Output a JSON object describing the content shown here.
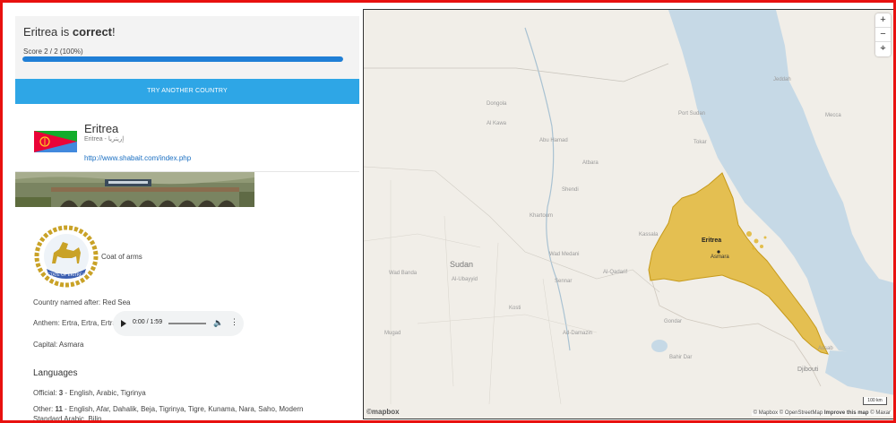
{
  "result": {
    "country": "Eritrea",
    "mid": " is ",
    "verdict": "correct",
    "end": "!",
    "score_text": "Score 2 / 2 (100%)",
    "score_fraction": 1.0
  },
  "try_button": "TRY ANOTHER COUNTRY",
  "card": {
    "name": "Eritrea",
    "native": "Eritrea - إريتريا",
    "url": "http://www.shabait.com/index.php"
  },
  "coat_of_arms_label": "Coat of arms",
  "coat_of_arms_motto": "STATE OF ERITREA",
  "named_after": "Country named after: Red Sea",
  "anthem": "Anthem: Ertra, Ertra, Ertra",
  "audio": {
    "time": "0:00 / 1:59",
    "progress_fraction": 0.0
  },
  "capital": "Capital: Asmara",
  "languages": {
    "heading": "Languages",
    "official_prefix": "Official: ",
    "official_count": "3",
    "official_list": " - English, Arabic, Tigrinya",
    "other_prefix": "Other: ",
    "other_count": "11",
    "other_list": " - English, Afar, Dahalik, Beja, Tigrinya, Tigre, Kunama, Nara, Saho, Modern Standard Arabic, Bilin"
  },
  "map": {
    "zoom_in": "+",
    "zoom_out": "−",
    "compass": "⌖",
    "labels": {
      "sudan": "Sudan",
      "eritrea": "Eritrea",
      "asmara": "Asmara",
      "djibouti": "Djibouti",
      "khartoum": "Khartoum",
      "port_sudan": "Port Sudan",
      "kassala": "Kassala",
      "wad_medani": "Wad Medani",
      "ad_damazin": "Ad-Damazin",
      "kosti": "Kosti",
      "al_ubayyid": "Al-Ubayyid",
      "wad_banda": "Wad Banda",
      "atbara": "Atbara",
      "dongola": "Dongola",
      "al_qadarif": "Al-Qadarif",
      "sennar": "Sennar",
      "al_kawa": "Al Kawa",
      "mugad": "Mugad",
      "shendi": "Shendi",
      "abu_hamad": "Abu Hamad",
      "tokar": "Tokar",
      "assab": "Assab",
      "jeddah": "Jeddah",
      "mecca": "Mecca",
      "bahir_dar": "Bahir Dar",
      "gondar": "Gondar"
    },
    "scale": "100 km",
    "logo": "©mapbox",
    "attribution": "© Mapbox © OpenStreetMap",
    "improve": "Improve this map",
    "maxar": "© Maxar"
  },
  "colors": {
    "border": "#e8110f",
    "button": "#2ea6e6",
    "progress": "#1f7fd6",
    "sea": "#c6d9e6",
    "highlight": "#e0b52f"
  }
}
